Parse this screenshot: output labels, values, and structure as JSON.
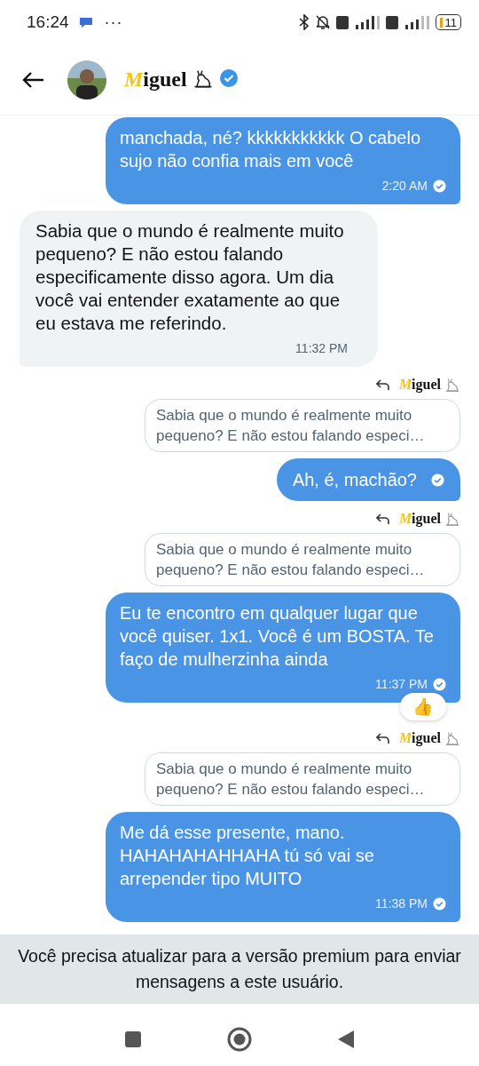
{
  "status_bar": {
    "time": "16:24",
    "more": "···",
    "battery": "11"
  },
  "header": {
    "name": "Miguel",
    "verified": true
  },
  "messages": [
    {
      "kind": "sent",
      "text": "manchada, né? kkkkkkkkkkk O cabelo sujo não confia mais em você",
      "time": "2:20 AM"
    },
    {
      "kind": "received",
      "text": "Sabia que o mundo é realmente muito pequeno? E não estou falando especificamente disso agora. Um dia você vai entender exatamente ao que eu estava me referindo.",
      "time": "11:32 PM"
    },
    {
      "kind": "reply",
      "name": "Miguel",
      "quote": "Sabia que o mundo é realmente muito pequeno? E não estou falando especi…"
    },
    {
      "kind": "sent",
      "text": "Ah, é, machão?"
    },
    {
      "kind": "reply",
      "name": "Miguel",
      "quote": "Sabia que o mundo é realmente muito pequeno? E não estou falando especi…"
    },
    {
      "kind": "sent",
      "text": "Eu te encontro em qualquer lugar que você quiser. 1x1. Você é um BOSTA. Te faço de mulherzinha ainda",
      "time": "11:37 PM",
      "reaction": "👍"
    },
    {
      "kind": "reply",
      "name": "Miguel",
      "quote": "Sabia que o mundo é realmente muito pequeno? E não estou falando especi…"
    },
    {
      "kind": "sent",
      "text": "Me dá esse presente, mano. HAHAHAHAHHAHA tú só vai se arrepender tipo MUITO",
      "time": "11:38 PM"
    }
  ],
  "notice": "Você precisa atualizar para a versão premium para enviar mensagens a este usuário."
}
